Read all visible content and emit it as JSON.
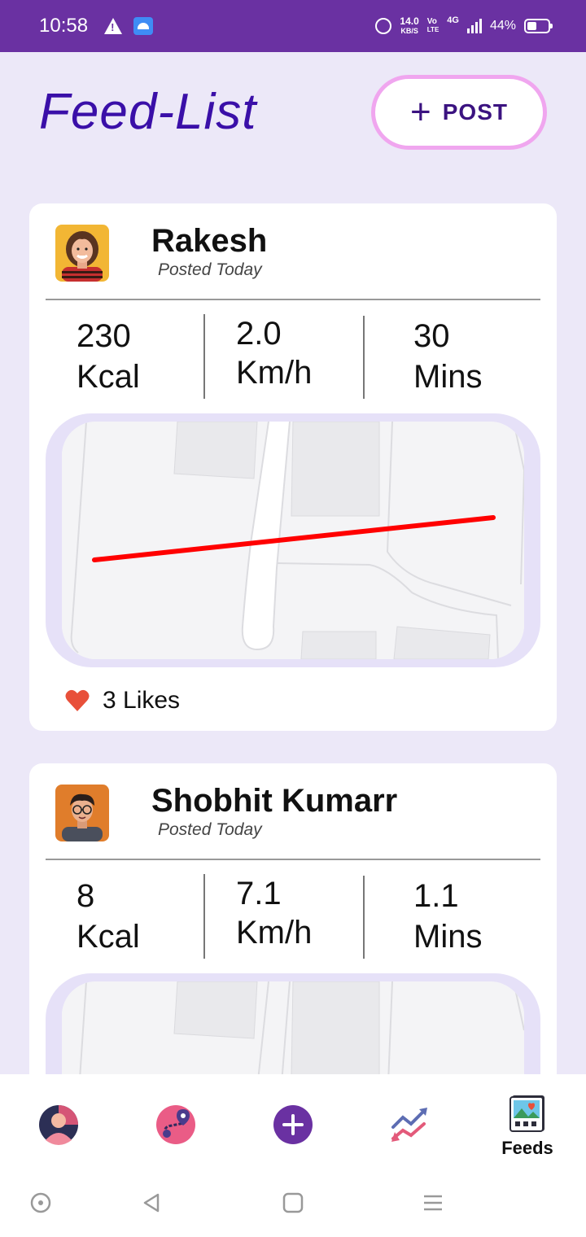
{
  "status_bar": {
    "time": "10:58",
    "net_speed_value": "14.0",
    "net_speed_unit": "KB/S",
    "volte_top": "Vo",
    "volte_bottom": "LTE",
    "network": "4G",
    "battery": "44%"
  },
  "header": {
    "title": "Feed-List",
    "post_button_label": "POST"
  },
  "feed": [
    {
      "user": "Rakesh",
      "posted": "Posted Today",
      "calories": "230",
      "calories_unit": "Kcal",
      "speed": "2.0",
      "speed_unit": "Km/h",
      "duration": "30",
      "duration_unit": "Mins",
      "likes": "3 Likes"
    },
    {
      "user": "Shobhit Kumarr",
      "posted": "Posted Today",
      "calories": "8",
      "calories_unit": "Kcal",
      "speed": "7.1",
      "speed_unit": "Km/h",
      "duration": "1.1",
      "duration_unit": "Mins"
    }
  ],
  "bottom_nav": {
    "feeds_label": "Feeds"
  },
  "colors": {
    "status_bar": "#6a31a2",
    "title": "#3a0fa8",
    "background": "#ece8f8",
    "route_line": "#ff0000",
    "heart": "#e8503a",
    "post_button_border": "#f0a6ef"
  }
}
